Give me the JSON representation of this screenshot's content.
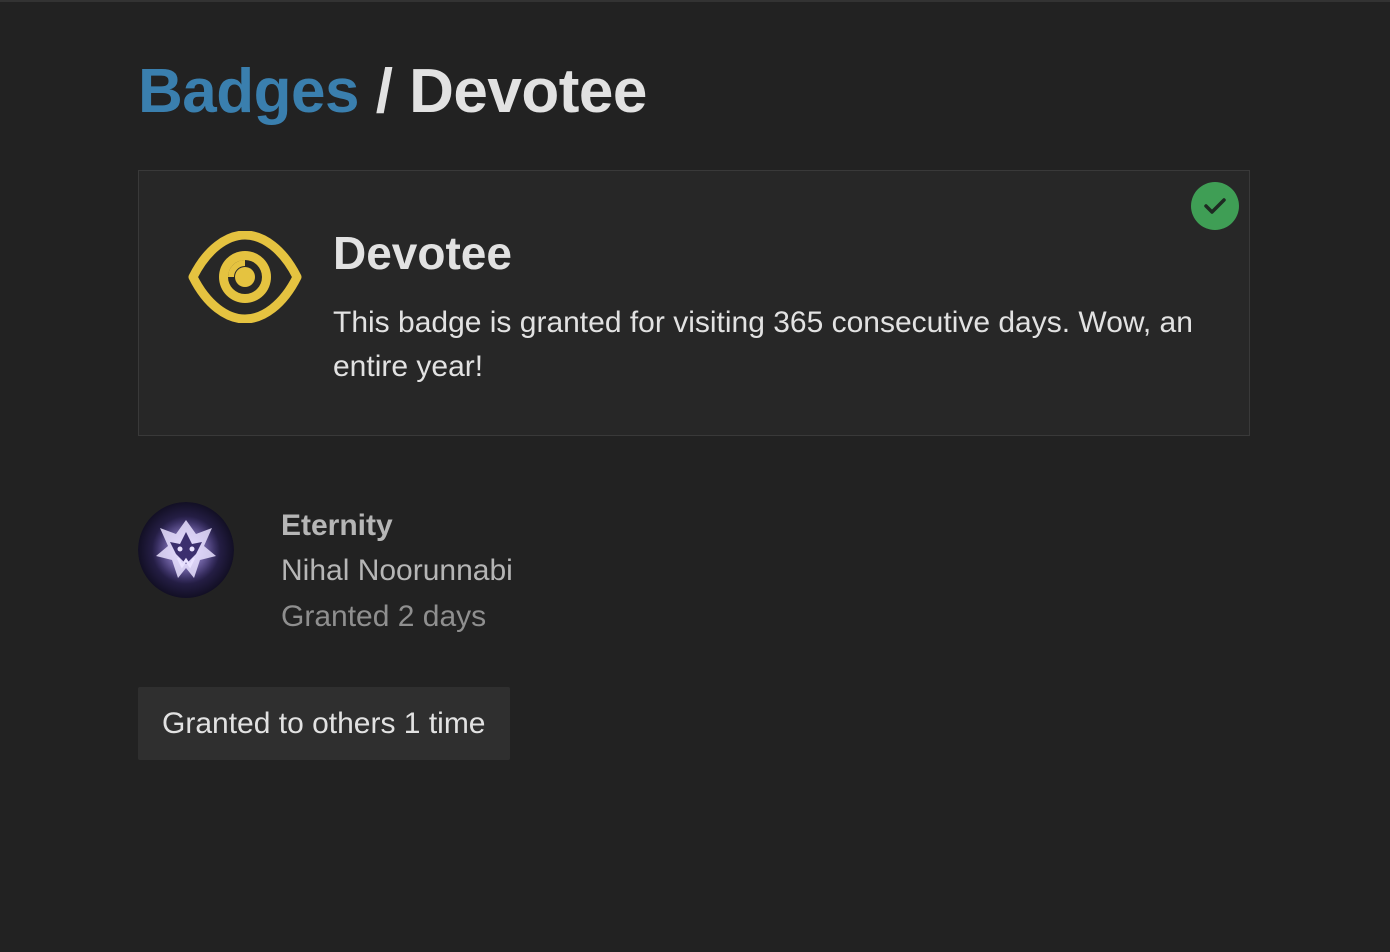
{
  "breadcrumb": {
    "parent": "Badges",
    "separator": " / ",
    "current": "Devotee"
  },
  "badge": {
    "name": "Devotee",
    "description": "This badge is granted for visiting 365 consecutive days. Wow, an entire year!",
    "icon": "eye-icon",
    "icon_color": "#e5c340",
    "granted": true,
    "granted_indicator_icon": "check-icon",
    "granted_indicator_color": "#3f9e55"
  },
  "grant": {
    "title": "Eternity",
    "user": "Nihal Noorunnabi",
    "date": "Granted 2 days",
    "avatar_icon": "avatar-emblem"
  },
  "others": {
    "label": "Granted to others 1 time"
  },
  "colors": {
    "background": "#222222",
    "link": "#3a7fae",
    "text": "#e2e2e2",
    "muted": "#8f8f8f"
  }
}
